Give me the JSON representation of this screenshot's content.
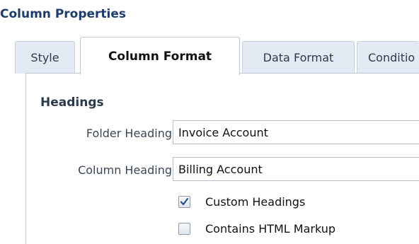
{
  "dialog": {
    "title": "Column Properties"
  },
  "tabs": [
    {
      "label": "Style",
      "active": false
    },
    {
      "label": "Column Format",
      "active": true
    },
    {
      "label": "Data Format",
      "active": false
    },
    {
      "label": "Conditio",
      "active": false
    }
  ],
  "headings": {
    "section_title": "Headings",
    "folder_heading": {
      "label": "Folder Heading",
      "value": "Invoice Account"
    },
    "column_heading": {
      "label": "Column Heading",
      "value": "Billing Account"
    },
    "custom_headings": {
      "label": "Custom Headings",
      "checked": true
    },
    "contains_html_markup": {
      "label": "Contains HTML Markup",
      "checked": false
    }
  },
  "colors": {
    "title": "#1c3c6e",
    "tab_background": "#e3eaf3",
    "border": "#b9c7d8",
    "check_tick": "#2a4f8f"
  }
}
